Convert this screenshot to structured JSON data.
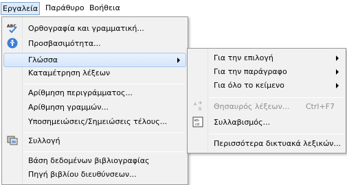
{
  "menubar": {
    "items": [
      {
        "label": "Εργαλεία"
      },
      {
        "label": "Παράθυρο"
      },
      {
        "label": "Βοήθεια"
      }
    ]
  },
  "tools_menu": {
    "items": [
      {
        "label": "Ορθογραφία και γραμματική...",
        "icon": "spellcheck-icon"
      },
      {
        "label": "Προσβασιμότητα...",
        "icon": "accessibility-icon"
      },
      {
        "label": "Γλώσσα"
      },
      {
        "label": "Καταμέτρηση λέξεων"
      },
      {
        "label": "Αρίθμηση περιγράμματος..."
      },
      {
        "label": "Αρίθμηση γραμμών..."
      },
      {
        "label": "Υποσημειώσεις/Σημειώσεις τέλους..."
      },
      {
        "label": "Συλλογή",
        "icon": "gallery-icon"
      },
      {
        "label": "Βάση δεδομένων βιβλιογραφίας"
      },
      {
        "label": "Πηγή βιβλίου διευθύνσεων..."
      }
    ]
  },
  "language_submenu": {
    "items": [
      {
        "label": "Για την επιλογή"
      },
      {
        "label": "Για την παράγραφο"
      },
      {
        "label": "Για όλο το κείμενο"
      },
      {
        "label": "Θησαυρός λέξεων...",
        "shortcut": "Ctrl+F7",
        "icon": "thesaurus-icon"
      },
      {
        "label": "Συλλαβισμός...",
        "icon": "hyphenation-icon"
      },
      {
        "label": "Περισσότερα δικτυακά λεξικών..."
      }
    ]
  },
  "icon_text": {
    "spellcheck": "ABC",
    "hyphenation_top": "ab-",
    "hyphenation_bottom": "cd"
  },
  "colors": {
    "accent": "#3c7fd6",
    "highlight": "#d6e6fa"
  }
}
